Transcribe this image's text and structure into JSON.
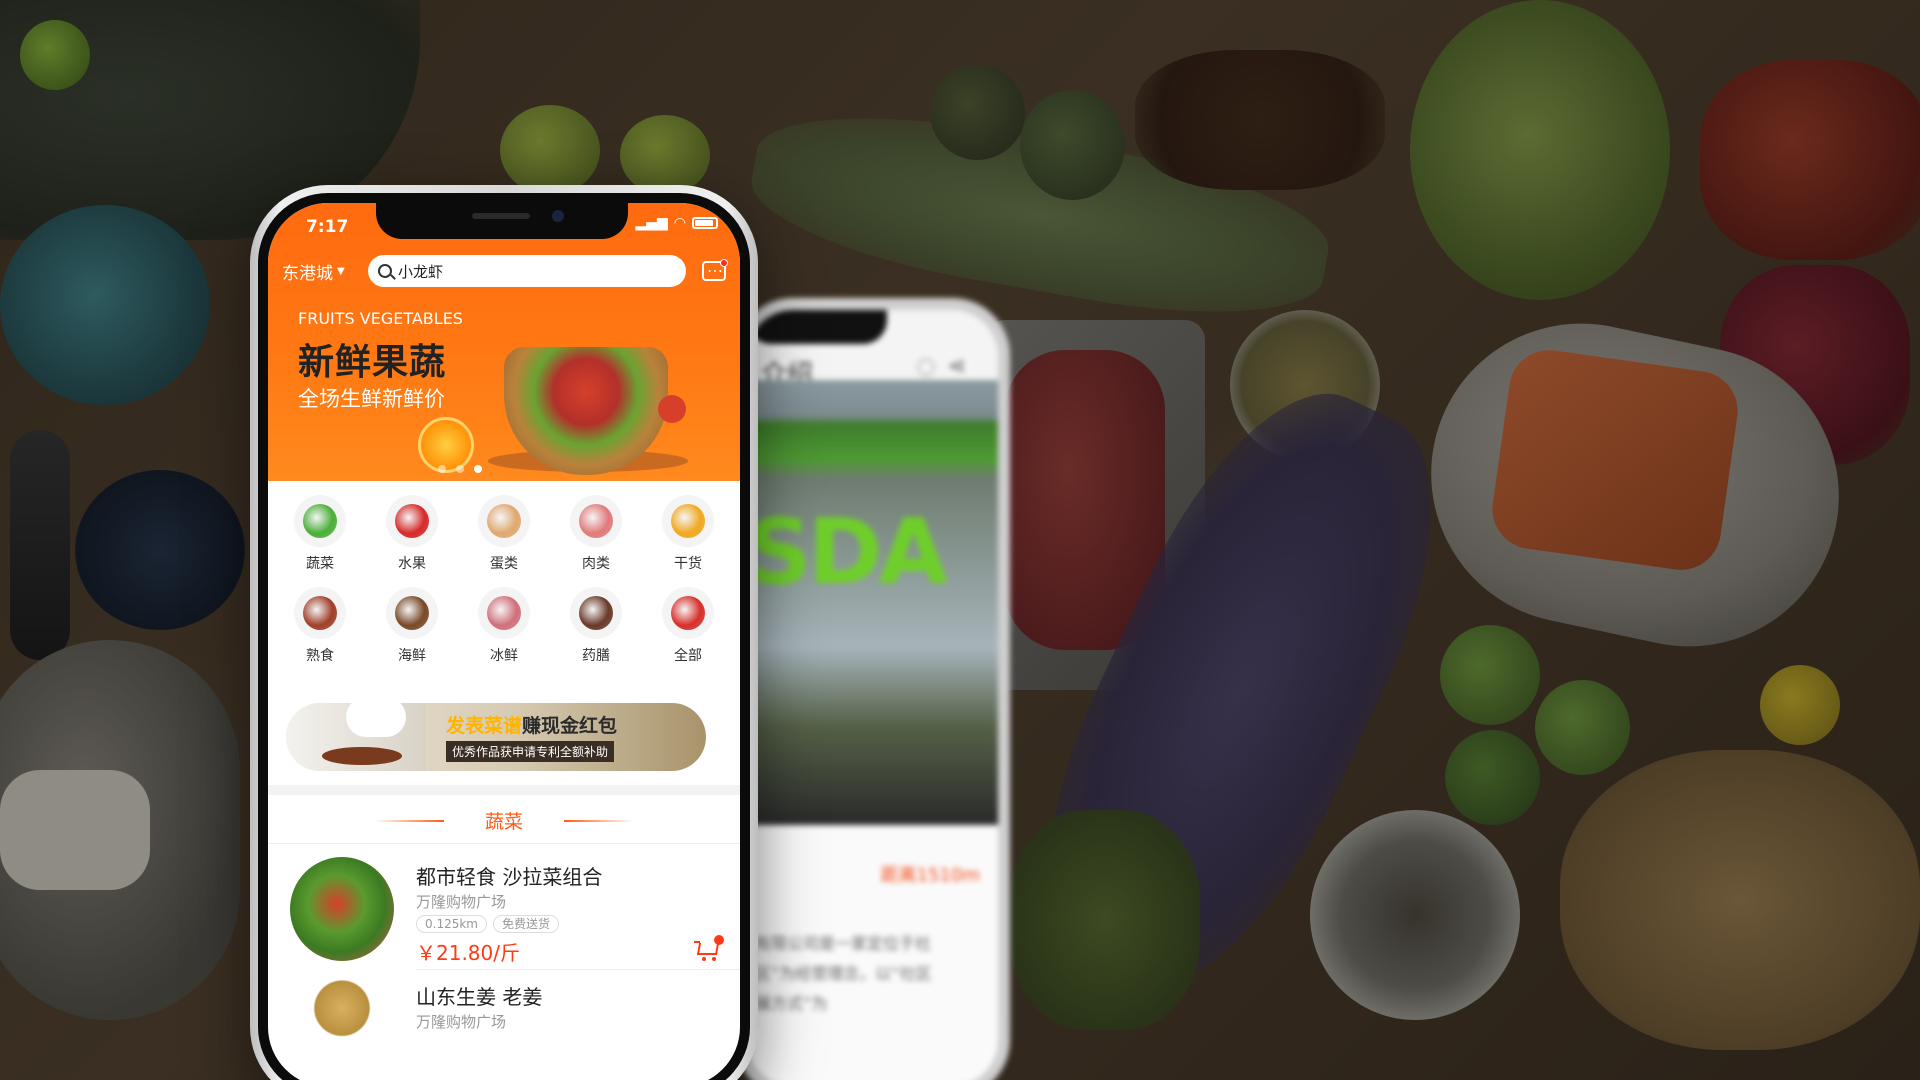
{
  "status_bar": {
    "time": "7:17"
  },
  "header": {
    "city": "东港城",
    "search_value": "小龙虾"
  },
  "banner": {
    "english": "FRUITS VEGETABLES",
    "title": "新鲜果蔬",
    "subtitle": "全场生鲜新鲜价",
    "slides": 3,
    "active_slide": 3
  },
  "categories": [
    {
      "label": "蔬菜",
      "color": "#4caf3a"
    },
    {
      "label": "水果",
      "color": "#d62a2a"
    },
    {
      "label": "蛋类",
      "color": "#e0a870"
    },
    {
      "label": "肉类",
      "color": "#e07a7a"
    },
    {
      "label": "干货",
      "color": "#f0a820"
    },
    {
      "label": "熟食",
      "color": "#a0402a"
    },
    {
      "label": "海鲜",
      "color": "#7a4a2a"
    },
    {
      "label": "冰鲜",
      "color": "#d0707a"
    },
    {
      "label": "药膳",
      "color": "#6a3a2a"
    },
    {
      "label": "全部",
      "color": "#d6302a"
    }
  ],
  "recipe_promo": {
    "title_highlight": "发表菜谱",
    "title_rest": "赚现金红包",
    "subtitle": "优秀作品获申请专利全额补助"
  },
  "section": {
    "title": "蔬菜"
  },
  "products": [
    {
      "name": "都市轻食 沙拉菜组合",
      "shop": "万隆购物广场",
      "distance": "0.125km",
      "delivery": "免费送货",
      "price": "￥21.80/斤"
    },
    {
      "name": "山东生姜 老姜",
      "shop": "万隆购物广场"
    }
  ],
  "back_phone": {
    "title": "介绍",
    "sign": "SDA",
    "distance": "距离1510m",
    "text_lines": [
      "有限公司是一家定位于社",
      "区”为经营理念，以“社区",
      "展方式”为"
    ]
  },
  "colors": {
    "accent": "#ff6a10",
    "price": "#ff3a14",
    "section": "#ff5a14"
  }
}
